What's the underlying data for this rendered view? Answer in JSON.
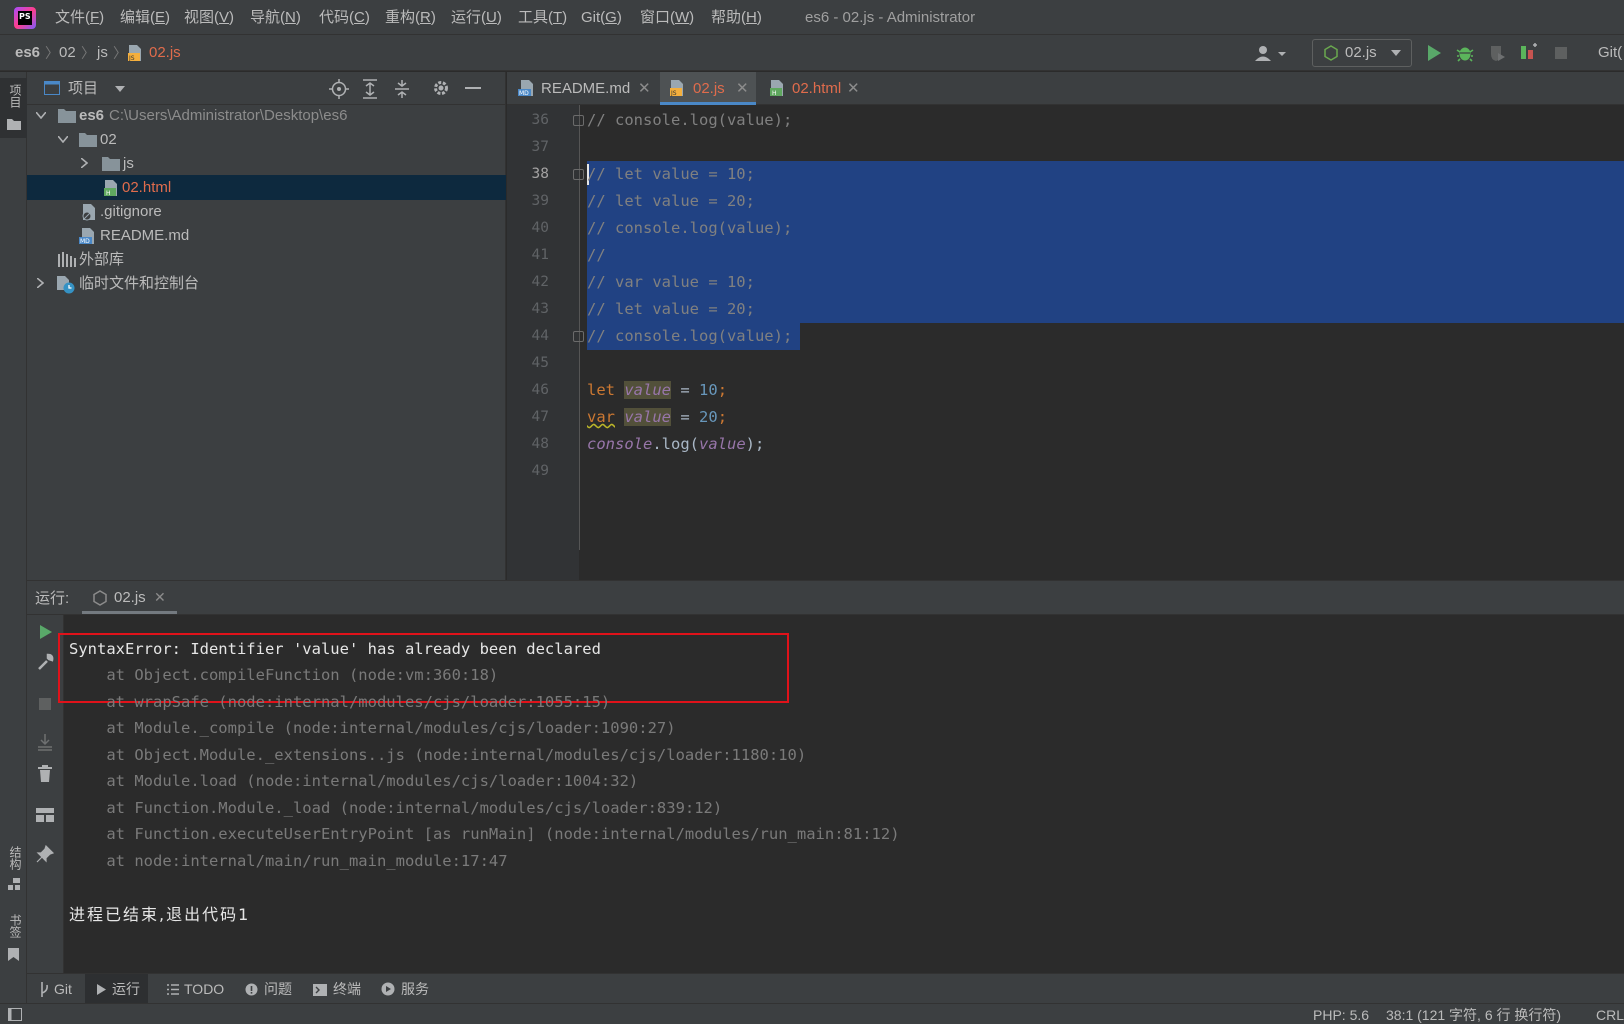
{
  "window": {
    "title": "es6 - 02.js - Administrator",
    "app_icon_text": "PS"
  },
  "menu": [
    {
      "label": "文件(",
      "key": "F",
      "end": ")"
    },
    {
      "label": "编辑(",
      "key": "E",
      "end": ")"
    },
    {
      "label": "视图(",
      "key": "V",
      "end": ")"
    },
    {
      "label": "导航(",
      "key": "N",
      "end": ")"
    },
    {
      "label": "代码(",
      "key": "C",
      "end": ")"
    },
    {
      "label": "重构(",
      "key": "R",
      "end": ")"
    },
    {
      "label": "运行(",
      "key": "U",
      "end": ")"
    },
    {
      "label": "工具(",
      "key": "T",
      "end": ")"
    },
    {
      "label": "Git(",
      "key": "G",
      "end": ")"
    },
    {
      "label": "窗口(",
      "key": "W",
      "end": ")"
    },
    {
      "label": "帮助(",
      "key": "H",
      "end": ")"
    }
  ],
  "breadcrumb": {
    "items": [
      "es6",
      "02",
      "js",
      "02.js"
    ]
  },
  "nav_toolbar": {
    "run_config": "02.js",
    "git_label": "Git("
  },
  "left_stripe": {
    "project": "项目",
    "structure": "结构",
    "bookmarks": "书签"
  },
  "project_panel": {
    "title": "项目",
    "tree": [
      {
        "name": "es6",
        "path": "C:\\Users\\Administrator\\Desktop\\es6",
        "bold": true
      },
      {
        "name": "02"
      },
      {
        "name": "js"
      },
      {
        "name": "02.html",
        "selected": true
      },
      {
        "name": ".gitignore"
      },
      {
        "name": "README.md"
      },
      {
        "name": "外部库"
      },
      {
        "name": "临时文件和控制台"
      }
    ]
  },
  "editor": {
    "tabs": [
      {
        "label": "README.md",
        "color": "#bbbbbb"
      },
      {
        "label": "02.js",
        "color": "#e06c4c",
        "active": true
      },
      {
        "label": "02.html",
        "color": "#e06c4c"
      }
    ],
    "line_numbers": [
      "36",
      "37",
      "38",
      "39",
      "40",
      "41",
      "42",
      "43",
      "44",
      "45",
      "46",
      "47",
      "48",
      "49"
    ],
    "lines": {
      "l36": "// console.log(value);",
      "l38": "// let value = 10;",
      "l39": "// let value = 20;",
      "l40": "// console.log(value);",
      "l41": "//",
      "l42": "// var value = 10;",
      "l43": "// let value = 20;",
      "l44": "// console.log(value);",
      "l46": {
        "kw": "let",
        "var": "value",
        "op": " = ",
        "num": "10",
        "end": ";"
      },
      "l47": {
        "kw": "var",
        "var": "value",
        "op": " = ",
        "num": "20",
        "end": ";"
      },
      "l48": {
        "obj": "console",
        "dot": ".log(",
        "arg": "value",
        "end": ");"
      }
    }
  },
  "run_panel": {
    "label": "运行:",
    "tab": "02.js",
    "output": {
      "error": "SyntaxError: Identifier 'value' has already been declared",
      "trace": [
        "    at Object.compileFunction (node:vm:360:18)",
        "    at wrapSafe (node:internal/modules/cjs/loader:1055:15)",
        "    at Module._compile (node:internal/modules/cjs/loader:1090:27)",
        "    at Object.Module._extensions..js (node:internal/modules/cjs/loader:1180:10)",
        "    at Module.load (node:internal/modules/cjs/loader:1004:32)",
        "    at Function.Module._load (node:internal/modules/cjs/loader:839:12)",
        "    at Function.executeUserEntryPoint [as runMain] (node:internal/modules/run_main:81:12)",
        "    at node:internal/main/run_main_module:17:47"
      ],
      "exit": "进程已结束,退出代码1"
    }
  },
  "bottom_tools": [
    "Git",
    "运行",
    "TODO",
    "问题",
    "终端",
    "服务"
  ],
  "status_bar": {
    "php": "PHP: 5.6",
    "position": "38:1 (121 字符, 6 行 换行符)",
    "crlf": "CRL"
  },
  "colors": {
    "error_box": "#e0121a",
    "selection": "#214283",
    "run_green": "#59a869",
    "debug_green": "#5bb55b"
  }
}
